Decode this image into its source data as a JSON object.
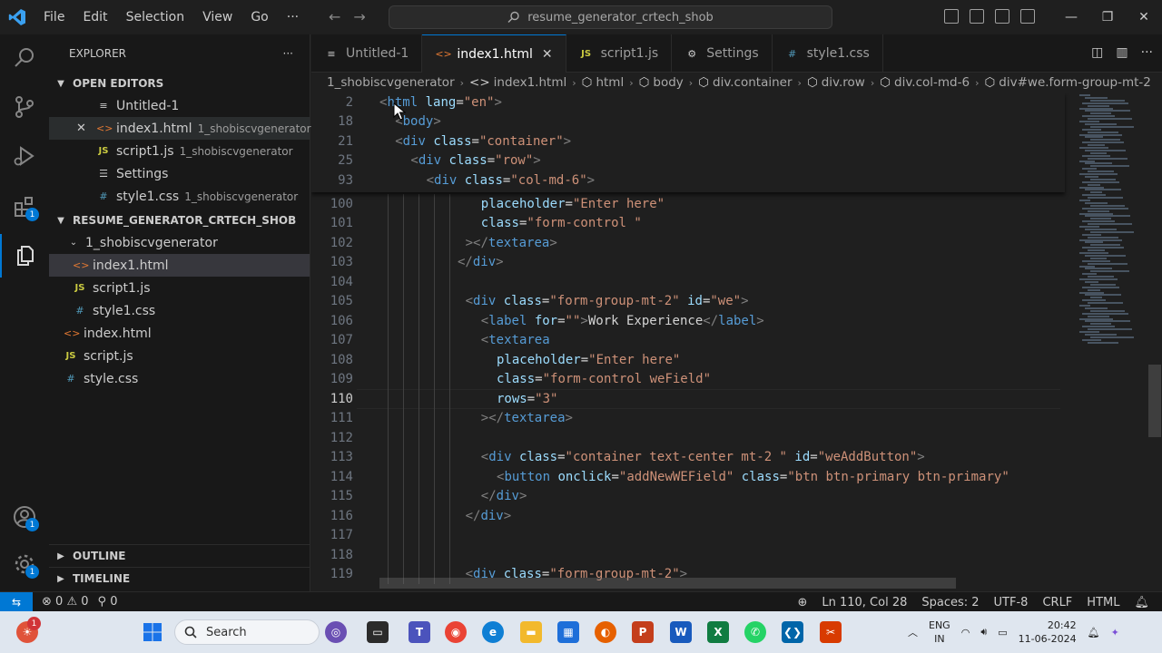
{
  "menu": [
    "File",
    "Edit",
    "Selection",
    "View",
    "Go",
    "···"
  ],
  "command_center": "resume_generator_crtech_shob",
  "explorer": {
    "title": "EXPLORER",
    "more": "···",
    "open_editors": {
      "title": "OPEN EDITORS",
      "items": [
        {
          "name": "Untitled-1",
          "desc": ""
        },
        {
          "name": "index1.html",
          "desc": "1_shobiscvgenerator"
        },
        {
          "name": "script1.js",
          "desc": "1_shobiscvgenerator"
        },
        {
          "name": "Settings",
          "desc": ""
        },
        {
          "name": "style1.css",
          "desc": "1_shobiscvgenerator"
        }
      ]
    },
    "project": {
      "title": "RESUME_GENERATOR_CRTECH_SHOB",
      "folder": "1_shobiscvgenerator",
      "folder_files": [
        "index1.html",
        "script1.js",
        "style1.css"
      ],
      "root_files": [
        "index.html",
        "script.js",
        "style.css"
      ]
    },
    "outline": "OUTLINE",
    "timeline": "TIMELINE"
  },
  "activity_badges": {
    "extensions": "1",
    "accounts": "1",
    "manage": "1"
  },
  "tabs": [
    {
      "label": "Untitled-1",
      "icon": "≡"
    },
    {
      "label": "index1.html",
      "icon": "<>"
    },
    {
      "label": "script1.js",
      "icon": "JS"
    },
    {
      "label": "Settings",
      "icon": "⚙"
    },
    {
      "label": "style1.css",
      "icon": "#"
    }
  ],
  "tab_close": "✕",
  "breadcrumb": [
    "1_shobiscvgenerator",
    "index1.html",
    "html",
    "body",
    "div.container",
    "div.row",
    "div.col-md-6",
    "div#we.form-group-mt-2"
  ],
  "sticky_lines": [
    {
      "n": "2",
      "indent": 0,
      "tokens": [
        [
          "brk",
          "<"
        ],
        [
          "tag",
          "html"
        ],
        [
          "attr",
          " lang"
        ],
        [
          "txt",
          "="
        ],
        [
          "str",
          "\"en\""
        ],
        [
          "brk",
          ">"
        ]
      ]
    },
    {
      "n": "18",
      "indent": 1,
      "tokens": [
        [
          "brk",
          "<"
        ],
        [
          "tag",
          "body"
        ],
        [
          "brk",
          ">"
        ]
      ]
    },
    {
      "n": "21",
      "indent": 1,
      "tokens": [
        [
          "brk",
          "<"
        ],
        [
          "tag",
          "div"
        ],
        [
          "attr",
          " class"
        ],
        [
          "txt",
          "="
        ],
        [
          "str",
          "\"container\""
        ],
        [
          "brk",
          ">"
        ]
      ]
    },
    {
      "n": "25",
      "indent": 2,
      "tokens": [
        [
          "brk",
          "<"
        ],
        [
          "tag",
          "div"
        ],
        [
          "attr",
          " class"
        ],
        [
          "txt",
          "="
        ],
        [
          "str",
          "\"row\""
        ],
        [
          "brk",
          ">"
        ]
      ]
    },
    {
      "n": "93",
      "indent": 3,
      "tokens": [
        [
          "brk",
          "<"
        ],
        [
          "tag",
          "div"
        ],
        [
          "attr",
          " class"
        ],
        [
          "txt",
          "="
        ],
        [
          "str",
          "\"col-md-6\""
        ],
        [
          "brk",
          ">"
        ]
      ]
    }
  ],
  "code_lines": [
    {
      "n": "100",
      "indent": 6.5,
      "tokens": [
        [
          "attr",
          "placeholder"
        ],
        [
          "txt",
          "="
        ],
        [
          "str",
          "\"Enter here\""
        ]
      ]
    },
    {
      "n": "101",
      "indent": 6.5,
      "tokens": [
        [
          "attr",
          "class"
        ],
        [
          "txt",
          "="
        ],
        [
          "str",
          "\"form-control \""
        ]
      ]
    },
    {
      "n": "102",
      "indent": 5.5,
      "tokens": [
        [
          "brk",
          "></"
        ],
        [
          "tag",
          "textarea"
        ],
        [
          "brk",
          ">"
        ]
      ]
    },
    {
      "n": "103",
      "indent": 5,
      "tokens": [
        [
          "brk",
          "</"
        ],
        [
          "tag",
          "div"
        ],
        [
          "brk",
          ">"
        ]
      ]
    },
    {
      "n": "104",
      "indent": 0,
      "tokens": []
    },
    {
      "n": "105",
      "indent": 5.5,
      "tokens": [
        [
          "brk",
          "<"
        ],
        [
          "tag",
          "div"
        ],
        [
          "attr",
          " class"
        ],
        [
          "txt",
          "="
        ],
        [
          "str",
          "\"form-group-mt-2\""
        ],
        [
          "attr",
          " id"
        ],
        [
          "txt",
          "="
        ],
        [
          "str",
          "\"we\""
        ],
        [
          "brk",
          ">"
        ]
      ]
    },
    {
      "n": "106",
      "indent": 6.5,
      "tokens": [
        [
          "brk",
          "<"
        ],
        [
          "tag",
          "label"
        ],
        [
          "attr",
          " for"
        ],
        [
          "txt",
          "="
        ],
        [
          "str",
          "\"\""
        ],
        [
          "brk",
          ">"
        ],
        [
          "txt",
          "Work Experience"
        ],
        [
          "brk",
          "</"
        ],
        [
          "tag",
          "label"
        ],
        [
          "brk",
          ">"
        ]
      ]
    },
    {
      "n": "107",
      "indent": 6.5,
      "tokens": [
        [
          "brk",
          "<"
        ],
        [
          "tag",
          "textarea"
        ]
      ]
    },
    {
      "n": "108",
      "indent": 7.5,
      "tokens": [
        [
          "attr",
          "placeholder"
        ],
        [
          "txt",
          "="
        ],
        [
          "str",
          "\"Enter here\""
        ]
      ]
    },
    {
      "n": "109",
      "indent": 7.5,
      "tokens": [
        [
          "attr",
          "class"
        ],
        [
          "txt",
          "="
        ],
        [
          "str",
          "\"form-control weField\""
        ]
      ]
    },
    {
      "n": "110",
      "indent": 7.5,
      "tokens": [
        [
          "attr",
          "rows"
        ],
        [
          "txt",
          "="
        ],
        [
          "str",
          "\"3\""
        ]
      ]
    },
    {
      "n": "111",
      "indent": 6.5,
      "tokens": [
        [
          "brk",
          "></"
        ],
        [
          "tag",
          "textarea"
        ],
        [
          "brk",
          ">"
        ]
      ]
    },
    {
      "n": "112",
      "indent": 0,
      "tokens": []
    },
    {
      "n": "113",
      "indent": 6.5,
      "tokens": [
        [
          "brk",
          "<"
        ],
        [
          "tag",
          "div"
        ],
        [
          "attr",
          " class"
        ],
        [
          "txt",
          "="
        ],
        [
          "str",
          "\"container text-center mt-2 \""
        ],
        [
          "attr",
          " id"
        ],
        [
          "txt",
          "="
        ],
        [
          "str",
          "\"weAddButton\""
        ],
        [
          "brk",
          ">"
        ]
      ]
    },
    {
      "n": "114",
      "indent": 7.5,
      "tokens": [
        [
          "brk",
          "<"
        ],
        [
          "tag",
          "button"
        ],
        [
          "attr",
          " onclick"
        ],
        [
          "txt",
          "="
        ],
        [
          "str",
          "\"addNewWEField\""
        ],
        [
          "attr",
          " class"
        ],
        [
          "txt",
          "="
        ],
        [
          "str",
          "\"btn btn-primary btn-primary\""
        ]
      ]
    },
    {
      "n": "115",
      "indent": 6.5,
      "tokens": [
        [
          "brk",
          "</"
        ],
        [
          "tag",
          "div"
        ],
        [
          "brk",
          ">"
        ]
      ]
    },
    {
      "n": "116",
      "indent": 5.5,
      "tokens": [
        [
          "brk",
          "</"
        ],
        [
          "tag",
          "div"
        ],
        [
          "brk",
          ">"
        ]
      ]
    },
    {
      "n": "117",
      "indent": 0,
      "tokens": []
    },
    {
      "n": "118",
      "indent": 0,
      "tokens": []
    },
    {
      "n": "119",
      "indent": 5.5,
      "tokens": [
        [
          "brk",
          "<"
        ],
        [
          "tag",
          "div"
        ],
        [
          "attr",
          " class"
        ],
        [
          "txt",
          "="
        ],
        [
          "str",
          "\"form-group-mt-2\""
        ],
        [
          "brk",
          ">"
        ]
      ]
    }
  ],
  "current_line": "110",
  "statusbar": {
    "errors": "0",
    "warnings": "0",
    "ports": "0",
    "position": "Ln 110, Col 28",
    "spaces": "Spaces: 2",
    "encoding": "UTF-8",
    "eol": "CRLF",
    "language": "HTML"
  },
  "taskbar": {
    "search": "Search",
    "lang_top": "ENG",
    "lang_bottom": "IN",
    "time": "20:42",
    "date": "11-06-2024",
    "weather_badge": "1"
  },
  "colors": {
    "accent": "#0078d4",
    "editor_bg": "#1f1f1f",
    "sidebar_bg": "#181818"
  }
}
